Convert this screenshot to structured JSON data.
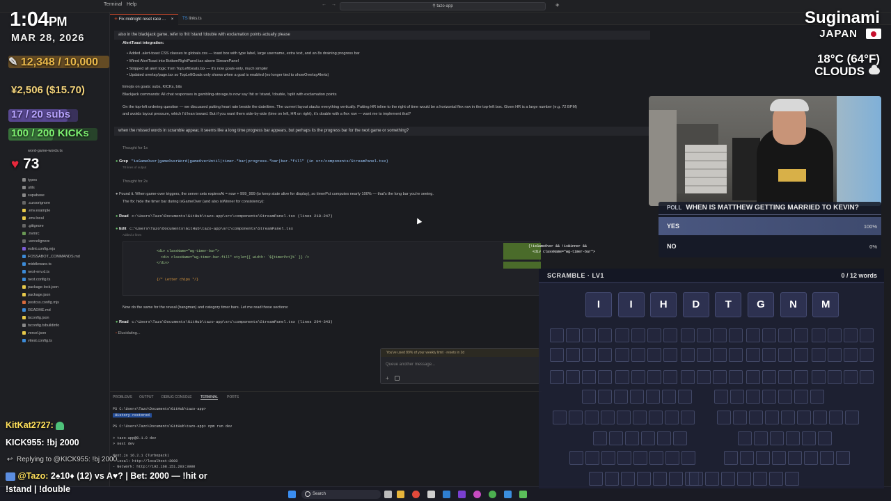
{
  "vscode": {
    "menu": [
      "Terminal",
      "Help"
    ],
    "search_label": "tazo-app",
    "tabs": [
      {
        "label": "Fix midnight reset race ...",
        "active": true
      },
      {
        "label": "links.ts",
        "active": false
      }
    ],
    "sidebar_files": [
      "types",
      "utils",
      "supabase",
      ".cursorignore",
      ".env.example",
      ".env.local",
      ".gitignore",
      ".nvmrc",
      ".vercelignore",
      "eslint.config.mjs",
      "FOSSABOT_COMMANDS.md",
      "middleware.ts",
      "next-env.d.ts",
      "next.config.ts",
      "package-lock.json",
      "package.json",
      "postcss.config.mjs",
      "README.md",
      "tsconfig.json",
      "tsconfig.tsbuildinfo",
      "vercel.json",
      "vitest.config.ts"
    ],
    "sidebar_top_item": "word-game-words.ts"
  },
  "chat": {
    "user_msg_1": "also in the blackjack game, refer to !hit !stand !double with exclamation points actually please",
    "alert_heading": "AlertToast integration:",
    "bullets": [
      "Added .alert-toast CSS classes to globals.css — toast box with type label, large username, extra text, and an 8s draining progress bar",
      "Wired AlertToast into BottomRightPanel.tsx above StreamPanel",
      "Stripped all alert logic from TopLeftGoals.tsx — it's now goals-only, much simpler",
      "Updated overlay/page.tsx so TopLeftGoals only shows when a goal is enabled (no longer tied to showOverlayAlerts)"
    ],
    "emojis_line": "Emojis on goals: subs, KICKs, bits",
    "blackjack_line": "Blackjack commands: All chat responses in gambling-storage.ts now say !hit or !stand, !double, !split with exclamation points",
    "ordering_para_1": "On the top-left ordering question — we discussed putting heart rate beside the date/time. The current layout stacks everything vertically. Putting HR inline to the right of time would be a horizontal flex row in the top-left box. Given HR is a large number (e.g. 72 BPM)",
    "ordering_para_2": "and avoids layout pressure, which I'd lean toward. But if you want them side-by-side (time on left, HR on right), it's doable with a flex row — want me to implement that?",
    "user_msg_2": "when the missed words in scramble appear, it seems like a long time progress bar appears, but perhaps its the progress bar for the next game or something?",
    "thought_1": "Thought for 1s",
    "grep_label": "Grep",
    "grep_text": "\"isGameOver|gameOverWord|gameOverUntil|timer.*bar|progress.*bar|bar.*fill\" (in src/components/StreamPanel.tsx)",
    "grep_sub": "78 lines of output",
    "thought_2": "Thought for 2s",
    "found_1": "Found it. When game-over triggers, the server sets expiresAt = now + 999_999 (to keep state alive for display), so timerPct computes nearly 100% — that's the long bar you're seeing.",
    "found_2": "The fix: hide the timer bar during isGameOver (and also isWinner for consistency):",
    "read_label": "Read",
    "read_1": "c:\\Users\\Tazo\\Documents\\GitHub\\tazo-app\\src\\components\\StreamPanel.tsx (lines 218-247)",
    "edit_label": "Edit",
    "edit_1": "c:\\Users\\Tazo\\Documents\\GitHub\\tazo-app\\src\\components\\StreamPanel.tsx",
    "edit_sub": "Added 2 lines",
    "code_left_1": "<div className=\"wg-timer-bar\">",
    "code_left_2": "<div className=\"wg-timer-bar-fill\" style={{ width: `${timerPct}%` }} />",
    "code_left_3": "</div>",
    "code_left_4": "{/* Letter chips */}",
    "code_right_1": "{!isGameOver && !isWinner &&",
    "code_right_2": "<div className=\"wg-timer-bar\">",
    "code_right_3": "<div className=\"wg-timer-bar-fill\" style={{ width: `${timerPct}%` }} />",
    "code_right_4": "</div>",
    "now_line": "Now do the same for the reveal (hangman) and category timer bars. Let me read those sections:",
    "read_2": "c:\\Users\\Tazo\\Documents\\GitHub\\tazo-app\\src\\components\\StreamPanel.tsx (lines 294-343)",
    "elucidating": "Elucidating...",
    "limit_notice": "You've used 89% of your weekly limit · resets in 2d",
    "input_placeholder": "Queue another message..."
  },
  "terminal": {
    "tabs": [
      "PROBLEMS",
      "OUTPUT",
      "DEBUG CONSOLE",
      "TERMINAL",
      "PORTS"
    ],
    "active_tab": "TERMINAL",
    "lines": [
      "PS C:\\Users\\Tazo\\Documents\\GitHub\\tazo-app>",
      "History restored",
      "PS C:\\Users\\Tazo\\Documents\\GitHub\\tazo-app> npm run dev",
      "> tazo-app@0.1.0 dev",
      "> next dev",
      "Next.js 16.2.1 (Turbopack)",
      "- Local:        http://localhost:3000",
      "- Network:      http://192.168.151.203:3000"
    ]
  },
  "overlay": {
    "time": "1:04",
    "ampm": "PM",
    "date": "MAR 28, 2026",
    "bits_goal": "12,348 / 10,000",
    "tips": "¥2,506 ($15.70)",
    "subs_goal": "17 / 20 subs",
    "kicks_goal": "100 / 200 KICKs",
    "heart_rate": "73",
    "city": "Suginami",
    "country": "JAPAN",
    "temperature": "18°C (64°F)",
    "condition": "CLOUDS",
    "colors": {
      "bits": "#e9b84a",
      "tips": "#f2d27a",
      "subs": "#b7a3ff",
      "kicks": "#7df070",
      "heart": "#e8283c"
    },
    "bars": {
      "bits": 1.0,
      "tips": 0.5,
      "subs": 0.85,
      "kicks": 0.5
    }
  },
  "poll": {
    "tag": "POLL",
    "question": "WHEN IS MATTHEW GETTING MARRIED TO KEVIN?",
    "options": [
      {
        "label": "YES",
        "pct_text": "100%",
        "pct": 100
      },
      {
        "label": "NO",
        "pct_text": "0%",
        "pct": 0
      }
    ]
  },
  "scramble": {
    "title": "SCRAMBLE · LV1",
    "count": "0 / 12 words",
    "letters": [
      "I",
      "I",
      "H",
      "D",
      "T",
      "G",
      "N",
      "M"
    ]
  },
  "stream_chat": {
    "line1_user": "KitKat2727:",
    "line2_user": "KICK955:",
    "line2_text": "!bj 2000",
    "reply": "Replying to @KICK955: !bj 2000",
    "line3_user": "@Tazo:",
    "line3_text": "2♠10♦ (12) vs A♥? | Bet: 2000 — !hit or",
    "line4_text": "!stand | !double"
  },
  "taskbar": {
    "search": "Search"
  }
}
